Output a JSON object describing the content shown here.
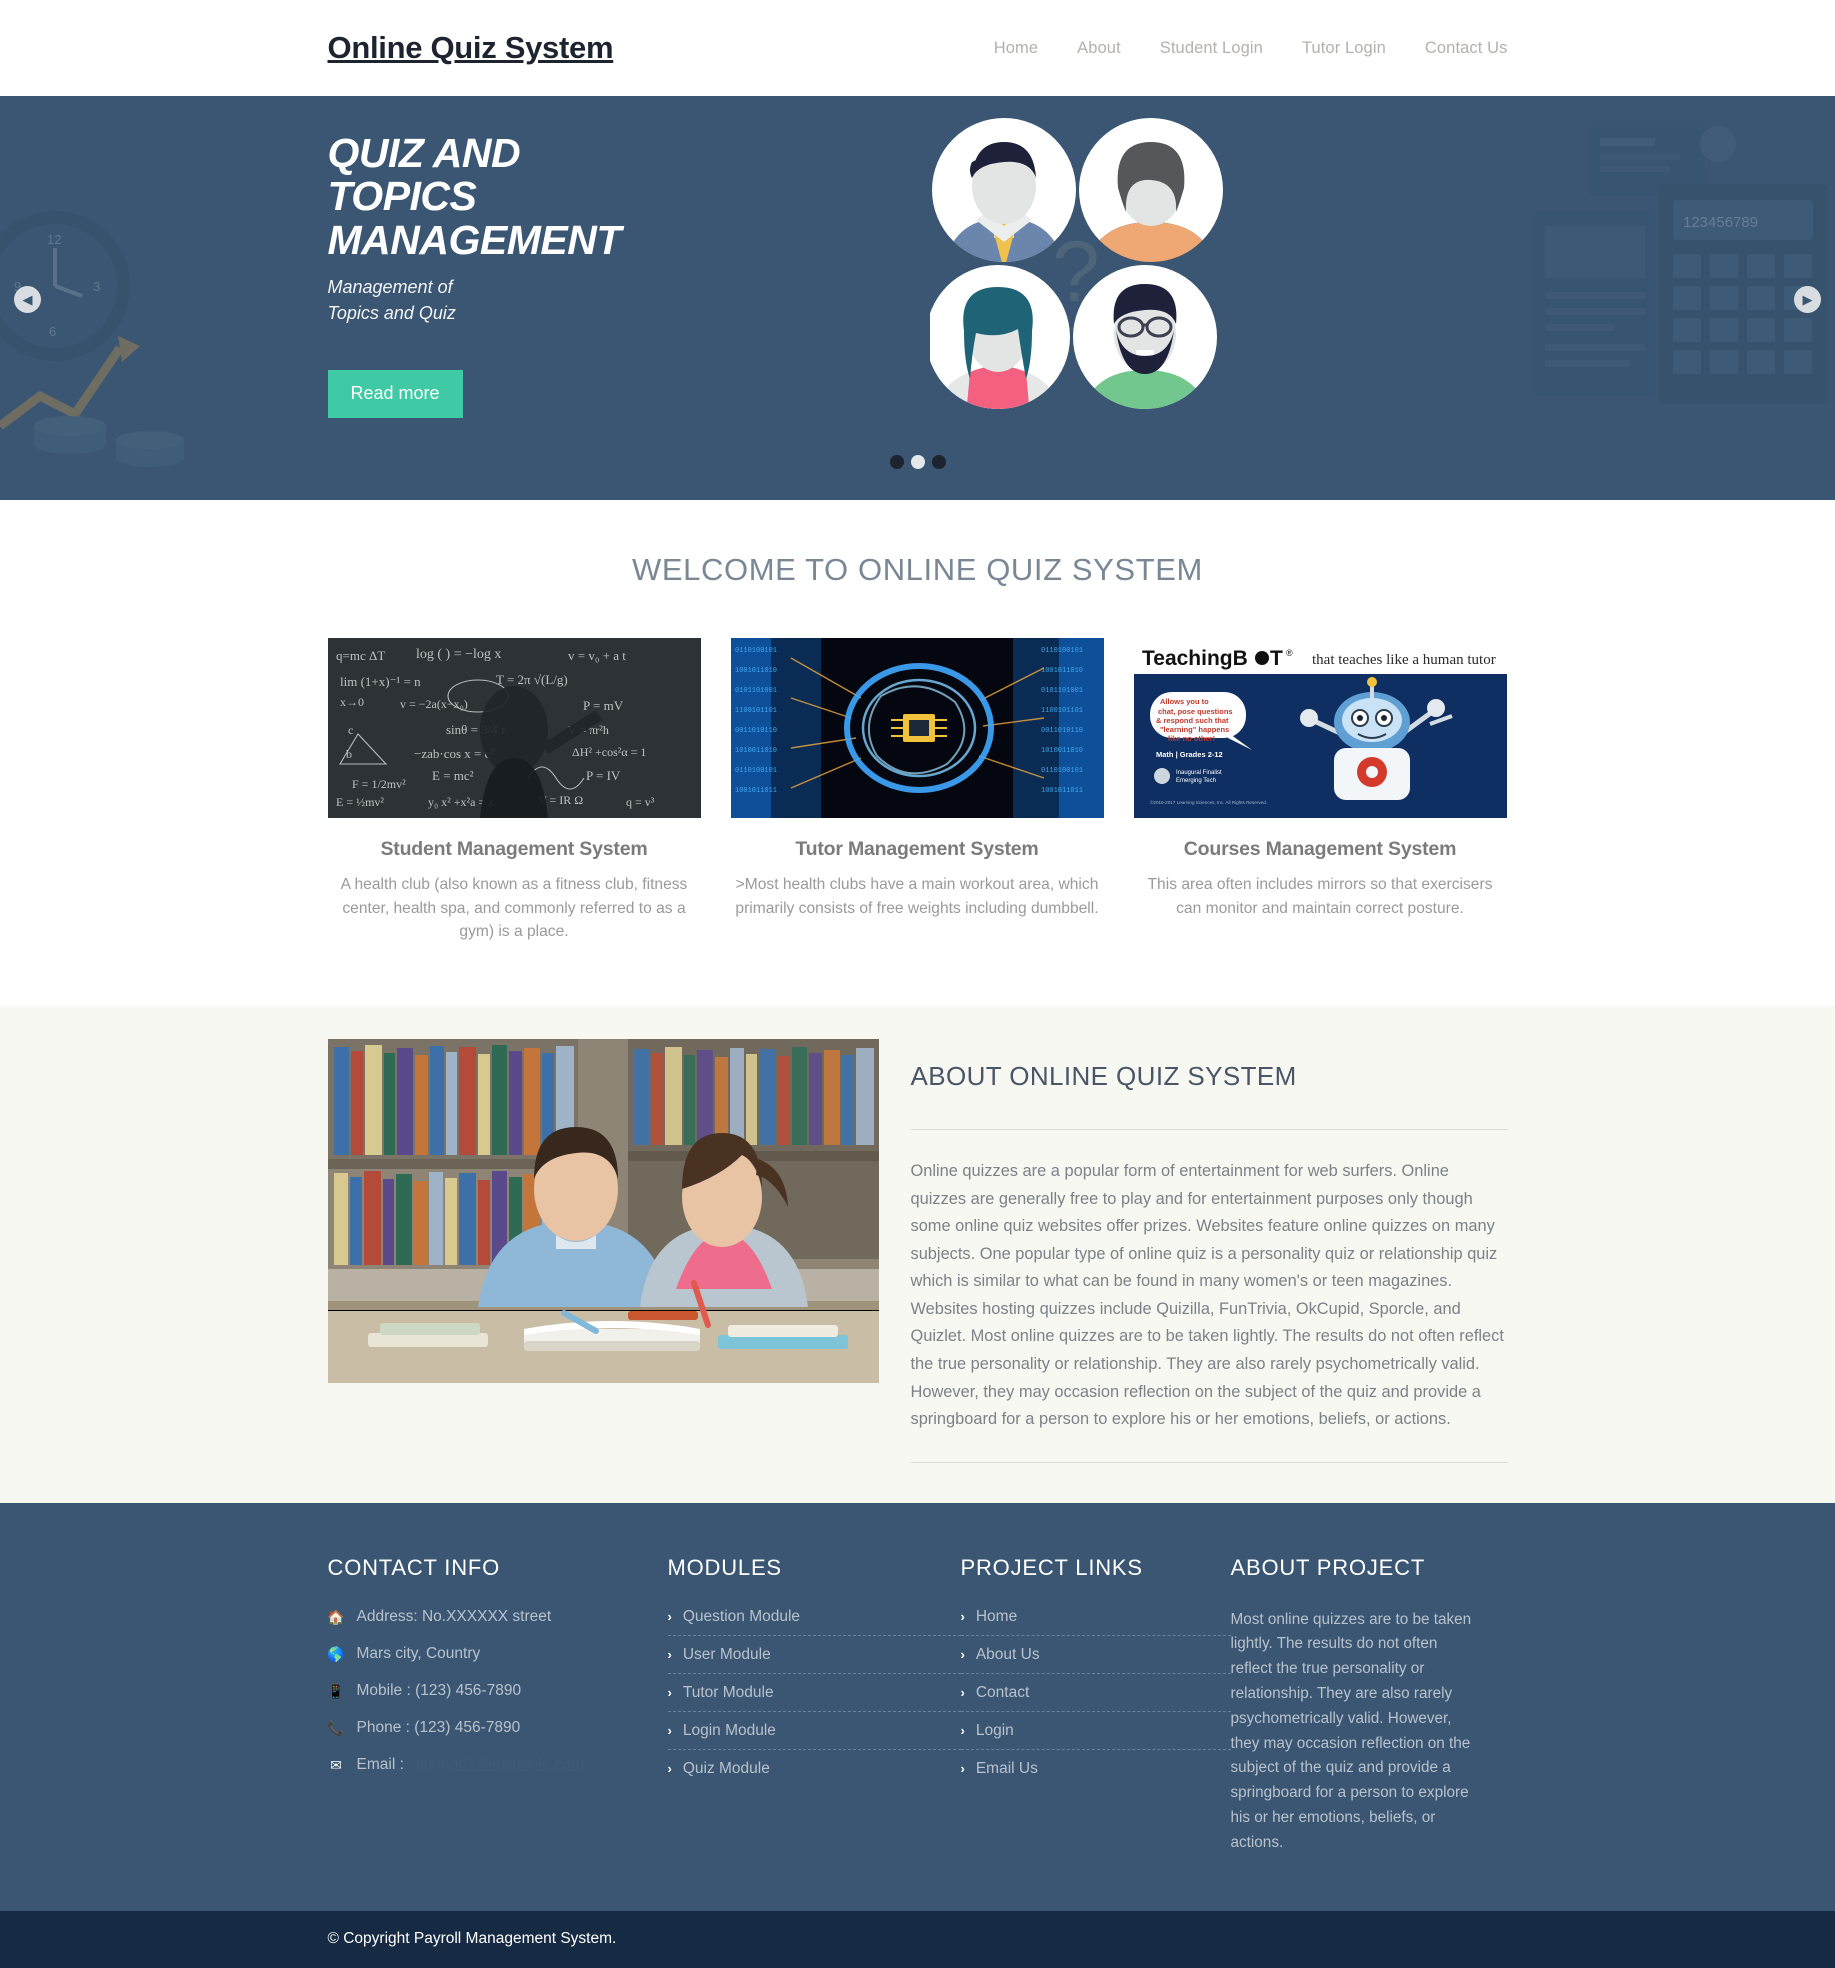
{
  "header": {
    "brand": "Online Quiz System",
    "nav": [
      {
        "label": "Home"
      },
      {
        "label": "About"
      },
      {
        "label": "Student Login"
      },
      {
        "label": "Tutor Login"
      },
      {
        "label": "Contact Us"
      }
    ]
  },
  "hero": {
    "title_line1": "QUIZ AND",
    "title_line2": "TOPICS",
    "title_line3": "MANAGEMENT",
    "subtitle_line1": "Management of",
    "subtitle_line2": "Topics and Quiz",
    "button_label": "Read more",
    "prev_icon": "chevron-left-icon",
    "next_icon": "chevron-right-icon",
    "slides": [
      {
        "active": false
      },
      {
        "active": true
      },
      {
        "active": false
      }
    ],
    "background_color": "#3a5672",
    "button_color": "#3fc9a4"
  },
  "welcome": {
    "heading": "WELCOME TO ONLINE QUIZ SYSTEM",
    "cards": [
      {
        "image_name": "blackboard-math-photo",
        "title": "Student Management System",
        "desc": "A health club (also known as a fitness club, fitness center, health spa, and commonly referred to as a gym) is a place."
      },
      {
        "image_name": "ai-brain-circuit-photo",
        "title": "Tutor Management System",
        "desc": ">Most health clubs have a main workout area, which primarily consists of free weights including dumbbell."
      },
      {
        "image_name": "teachingbot-banner-photo",
        "title": "Courses Management System",
        "desc": "This area often includes mirrors so that exercisers can monitor and maintain correct posture."
      }
    ]
  },
  "about": {
    "image_name": "students-studying-library-photo",
    "title": "ABOUT ONLINE QUIZ SYSTEM",
    "text": "Online quizzes are a popular form of entertainment for web surfers. Online quizzes are generally free to play and for entertainment purposes only though some online quiz websites offer prizes. Websites feature online quizzes on many subjects. One popular type of online quiz is a personality quiz or relationship quiz which is similar to what can be found in many women's or teen magazines. Websites hosting quizzes include Quizilla, FunTrivia, OkCupid, Sporcle, and Quizlet. Most online quizzes are to be taken lightly. The results do not often reflect the true personality or relationship. They are also rarely psychometrically valid. However, they may occasion reflection on the subject of the quiz and provide a springboard for a person to explore his or her emotions, beliefs, or actions.",
    "background_color": "#f7f8f2"
  },
  "footer": {
    "contact": {
      "title": "CONTACT INFO",
      "rows": [
        {
          "icon": "home-icon",
          "text": "Address: No.XXXXXX street"
        },
        {
          "icon": "globe-icon",
          "text": "Mars city, Country"
        },
        {
          "icon": "mobile-icon",
          "text": "Mobile : (123) 456-7890"
        },
        {
          "icon": "phone-icon",
          "text": "Phone : (123) 456-7890"
        }
      ],
      "email_icon": "envelope-icon",
      "email_label": "Email :",
      "email_value": "support1@example.com"
    },
    "modules": {
      "title": "MODULES",
      "items": [
        {
          "label": "Question Module"
        },
        {
          "label": "User Module"
        },
        {
          "label": "Tutor Module"
        },
        {
          "label": "Login Module"
        },
        {
          "label": "Quiz Module"
        }
      ]
    },
    "project_links": {
      "title": "PROJECT LINKS",
      "items": [
        {
          "label": "Home"
        },
        {
          "label": "About Us"
        },
        {
          "label": "Contact"
        },
        {
          "label": "Login"
        },
        {
          "label": "Email Us"
        }
      ]
    },
    "about_project": {
      "title": "ABOUT PROJECT",
      "text": "Most online quizzes are to be taken lightly. The results do not often reflect the true personality or relationship. They are also rarely psychometrically valid. However, they may occasion reflection on the subject of the quiz and provide a springboard for a person to explore his or her emotions, beliefs, or actions."
    },
    "background_color": "#3a5672"
  },
  "copyright": {
    "text": "© Copyright Payroll Management System.",
    "background_color": "#162a43"
  }
}
